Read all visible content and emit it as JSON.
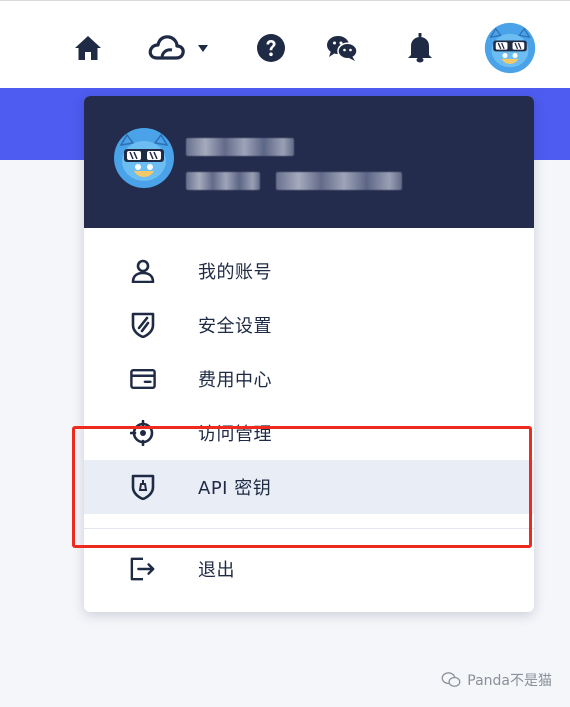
{
  "navbar": {
    "icons": [
      "home-icon",
      "cloud-icon",
      "help-icon",
      "wechat-icon",
      "bell-icon",
      "avatar"
    ],
    "cloud_has_dropdown": true
  },
  "user_menu": {
    "header": {
      "name_obscured": true,
      "id_obscured": true
    },
    "items": [
      {
        "label": "我的账号",
        "icon": "user-icon"
      },
      {
        "label": "安全设置",
        "icon": "shield-icon"
      },
      {
        "label": "费用中心",
        "icon": "wallet-icon"
      },
      {
        "label": "访问管理",
        "icon": "access-icon"
      },
      {
        "label": "API 密钥",
        "icon": "key-shield-icon",
        "active": true
      }
    ],
    "logout": {
      "label": "退出",
      "icon": "logout-icon"
    }
  },
  "watermark": {
    "text": "Panda不是猫"
  },
  "colors": {
    "band": "#4e5cf1",
    "menu_header": "#232c4c",
    "active_item": "#e9edf6",
    "highlight": "#ee2a1f",
    "icon": "#1f2a44"
  }
}
